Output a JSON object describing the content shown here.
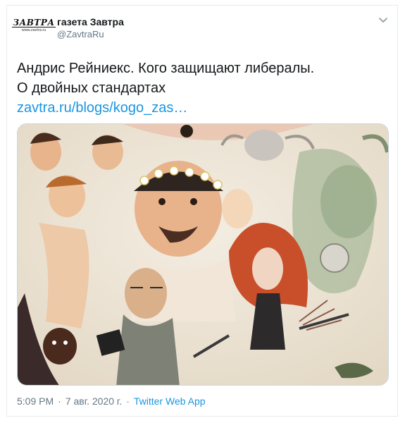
{
  "account": {
    "display_name": "газета Завтра",
    "handle": "@ZavtraRu",
    "avatar_logo_text": "ЗАВТРА",
    "avatar_logo_url": "www.zavtra.ru"
  },
  "tweet": {
    "text_line_1": "Андрис Рейниекс. Кого защищают либералы.",
    "text_line_2": "О двойных стандартах",
    "link_text": "zavtra.ru/blogs/kogo_zas…"
  },
  "footer": {
    "time": "5:09 PM",
    "separator": "·",
    "date": "7 авг. 2020 г.",
    "source": "Twitter Web App"
  },
  "icons": {
    "menu": "chevron-down-icon"
  },
  "colors": {
    "link": "#1b95e0",
    "secondary_text": "#657786",
    "border": "#e6ecf0"
  }
}
